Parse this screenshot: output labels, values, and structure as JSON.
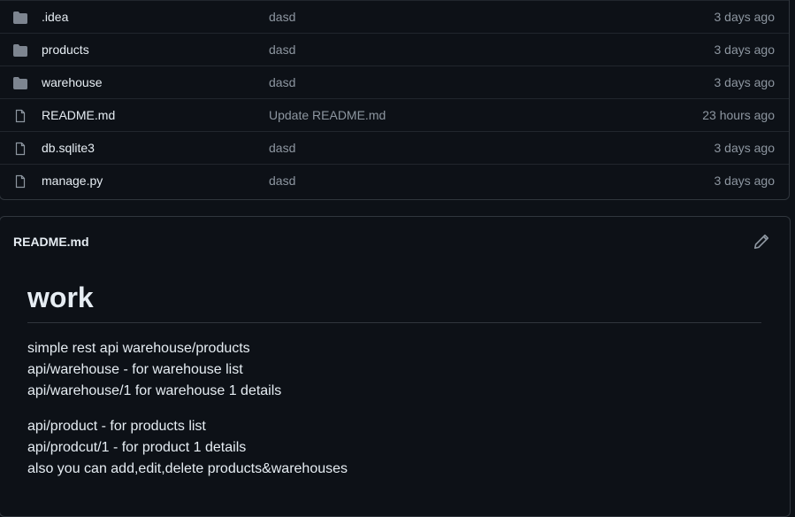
{
  "files": [
    {
      "type": "folder",
      "name": ".idea",
      "message": "dasd",
      "time": "3 days ago"
    },
    {
      "type": "folder",
      "name": "products",
      "message": "dasd",
      "time": "3 days ago"
    },
    {
      "type": "folder",
      "name": "warehouse",
      "message": "dasd",
      "time": "3 days ago"
    },
    {
      "type": "file",
      "name": "README.md",
      "message": "Update README.md",
      "time": "23 hours ago"
    },
    {
      "type": "file",
      "name": "db.sqlite3",
      "message": "dasd",
      "time": "3 days ago"
    },
    {
      "type": "file",
      "name": "manage.py",
      "message": "dasd",
      "time": "3 days ago"
    }
  ],
  "icons": {
    "folder": "folder-icon",
    "file": "file-icon",
    "edit": "pencil-icon"
  },
  "colors": {
    "background": "#0d1117",
    "border": "#30363d",
    "muted": "#8d96a0",
    "folder_icon": "#7d8590"
  },
  "readme": {
    "title": "README.md",
    "heading": "work",
    "paragraphs": [
      [
        "simple rest api warehouse/products",
        "api/warehouse - for warehouse list",
        "api/warehouse/1 for warehouse 1 details"
      ],
      [
        "api/product - for products list",
        "api/prodcut/1 - for product 1 details",
        "also you can add,edit,delete products&warehouses"
      ]
    ]
  }
}
